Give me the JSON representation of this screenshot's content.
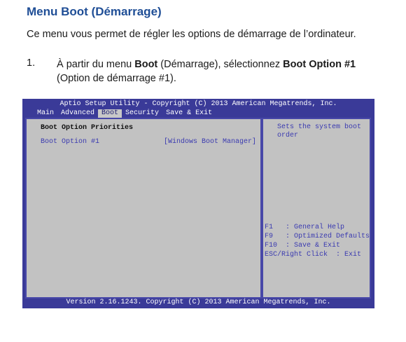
{
  "doc": {
    "heading": "Menu Boot (Démarrage)",
    "intro": "Ce menu vous permet de régler les options de démarrage de l’ordinateur.",
    "step_number": "1.",
    "step_parts": [
      "À partir du menu ",
      "Boot",
      " (Démarrage), sélectionnez ",
      "Boot Option #1",
      " (Option de démarrage #1)."
    ]
  },
  "bios": {
    "title": "Aptio Setup Utility - Copyright (C) 2013 American Megatrends, Inc.",
    "tabs": [
      "Main",
      "Advanced",
      "Boot",
      "Security",
      "Save & Exit"
    ],
    "active_tab": "Boot",
    "section_title": "Boot Option Priorities",
    "option_label": "Boot Option #1",
    "option_value": "[Windows Boot Manager]",
    "help_text": "Sets the system boot order",
    "keys": [
      "F1   : General Help",
      "F9   : Optimized Defaults",
      "F10  : Save & Exit",
      "ESC/Right Click  : Exit"
    ],
    "footer": "Version 2.16.1243. Copyright (C) 2013 American Megatrends, Inc.",
    "colors": {
      "frame": "#3a3a98",
      "panel": "#c2c2c2",
      "option_text": "#3a3ab0",
      "heading": "#1f4e96"
    }
  }
}
